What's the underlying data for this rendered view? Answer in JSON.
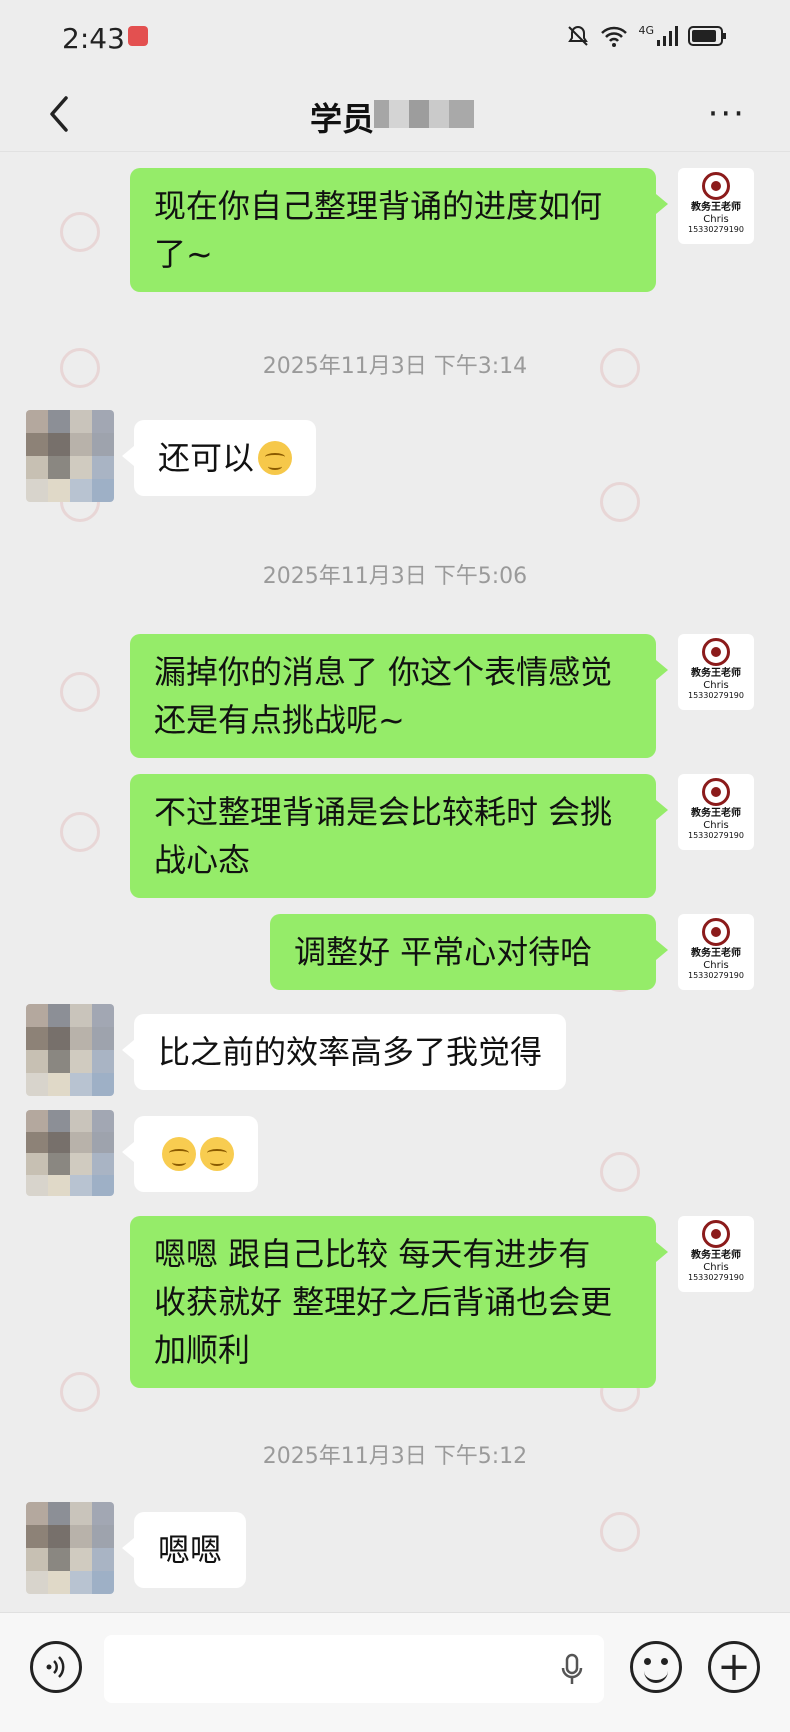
{
  "status_bar": {
    "time": "2:43",
    "network": "4G"
  },
  "header": {
    "title_prefix": "学员",
    "more_label": "···"
  },
  "teacher_avatar": {
    "line1": "教务王老师",
    "line2": "Chris",
    "line3": "15330279190"
  },
  "messages": [
    {
      "sender": "me",
      "text_lines": [
        "现在你自己整理背诵的进度如何",
        "了~"
      ]
    },
    {
      "type": "timestamp",
      "text": "2025年11月3日 下午3:14"
    },
    {
      "sender": "other",
      "text": "还可以",
      "emoji": "relieved"
    },
    {
      "type": "timestamp",
      "text": "2025年11月3日 下午5:06"
    },
    {
      "sender": "me",
      "text_lines": [
        "漏掉你的消息了  你这个表情感觉",
        "还是有点挑战呢~"
      ]
    },
    {
      "sender": "me",
      "text_lines": [
        "不过整理背诵是会比较耗时  会挑",
        "战心态"
      ]
    },
    {
      "sender": "me",
      "text_lines": [
        "调整好  平常心对待哈"
      ]
    },
    {
      "sender": "other",
      "text": "比之前的效率高多了我觉得"
    },
    {
      "sender": "other",
      "emoji": "blush-blush"
    },
    {
      "sender": "me",
      "text_lines": [
        "嗯嗯  跟自己比较   每天有进步有",
        "收获就好  整理好之后背诵也会更",
        "加顺利"
      ]
    },
    {
      "type": "timestamp",
      "text": "2025年11月3日 下午5:12"
    },
    {
      "sender": "other",
      "text": "嗯嗯"
    }
  ],
  "input_bar": {
    "placeholder": "",
    "icons": [
      "voice-icon",
      "mic-icon",
      "emoji-icon",
      "plus-icon"
    ]
  },
  "colors": {
    "my_bubble": "#95ec69",
    "other_bubble": "#ffffff",
    "background": "#ededed",
    "timestamp": "#9a9a9a"
  }
}
